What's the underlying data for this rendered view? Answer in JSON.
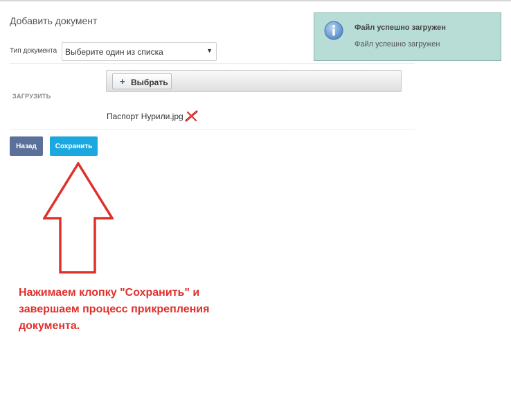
{
  "form": {
    "title": "Добавить документ",
    "doc_type_label": "Тип документа",
    "doc_type_select": {
      "selected": "Выберите один из списка"
    },
    "upload_label": "ЗАГРУЗИТЬ",
    "choose_button": "Выбрать",
    "uploaded_file": {
      "name": "Паспорт Нурили.jpg"
    },
    "back_button": "Назад",
    "save_button": "Сохранить"
  },
  "notification": {
    "title": "Файл успешно загружен",
    "message": "Файл успешно загружен"
  },
  "annotation": {
    "lines": [
      "Нажимаем клопку \"Сохранить\" и",
      "завершаем процесс прикрепления",
      "документа."
    ]
  },
  "colors": {
    "back_button": "#5c7199",
    "save_button": "#1ba8e0",
    "notification_bg": "#b8dcd6",
    "annotation": "#e0302c"
  },
  "icons": [
    "plus-icon",
    "remove-file-icon",
    "info-icon",
    "up-arrow-annotation"
  ]
}
